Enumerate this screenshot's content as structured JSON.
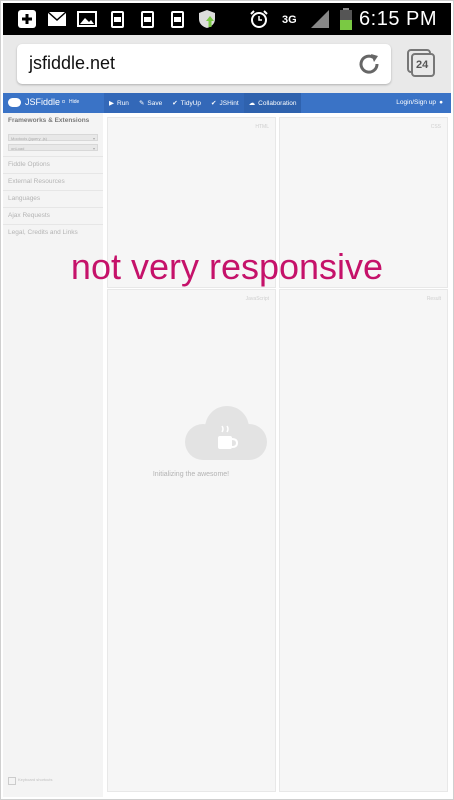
{
  "status_bar": {
    "time": "6:15 PM",
    "network": "3G",
    "icons": [
      "add-icon",
      "mail-icon",
      "image-icon",
      "phone-sync-icon",
      "phone-sync-icon",
      "phone-sync-icon",
      "shield-update-icon",
      "alarm-icon",
      "signal-icon",
      "battery-icon"
    ]
  },
  "browser": {
    "url": "jsfiddle.net",
    "tab_count": "24",
    "icons": [
      "reload-icon",
      "tabs-icon"
    ]
  },
  "jsfiddle": {
    "logo": "JSFiddle",
    "logo_suffix": "α",
    "hide": "Hide",
    "actions": [
      {
        "label": "Run",
        "icon": "play-icon"
      },
      {
        "label": "Save",
        "icon": "pencil-icon"
      },
      {
        "label": "TidyUp",
        "icon": "check-icon"
      },
      {
        "label": "JSHint",
        "icon": "check-icon"
      },
      {
        "label": "Collaboration",
        "icon": "cloud-icon"
      }
    ],
    "login": "Login/Sign up"
  },
  "sidebar": {
    "heading": "Frameworks & Extensions",
    "select1": "Mootools (jquery .js)",
    "select2": "onLoad",
    "items": [
      "Fiddle Options",
      "External Resources",
      "Languages",
      "Ajax Requests",
      "Legal, Credits and Links"
    ],
    "keyboard_label": "Keyboard shortcuts"
  },
  "panels": {
    "html": "HTML",
    "css": "CSS",
    "javascript": "JavaScript",
    "result": "Result"
  },
  "loading": {
    "text": "Initializing the awesome!"
  },
  "annotation": "not very responsive",
  "colors": {
    "accent": "#3a73c6",
    "annotation": "#c5126a",
    "status_bar": "#000000"
  }
}
